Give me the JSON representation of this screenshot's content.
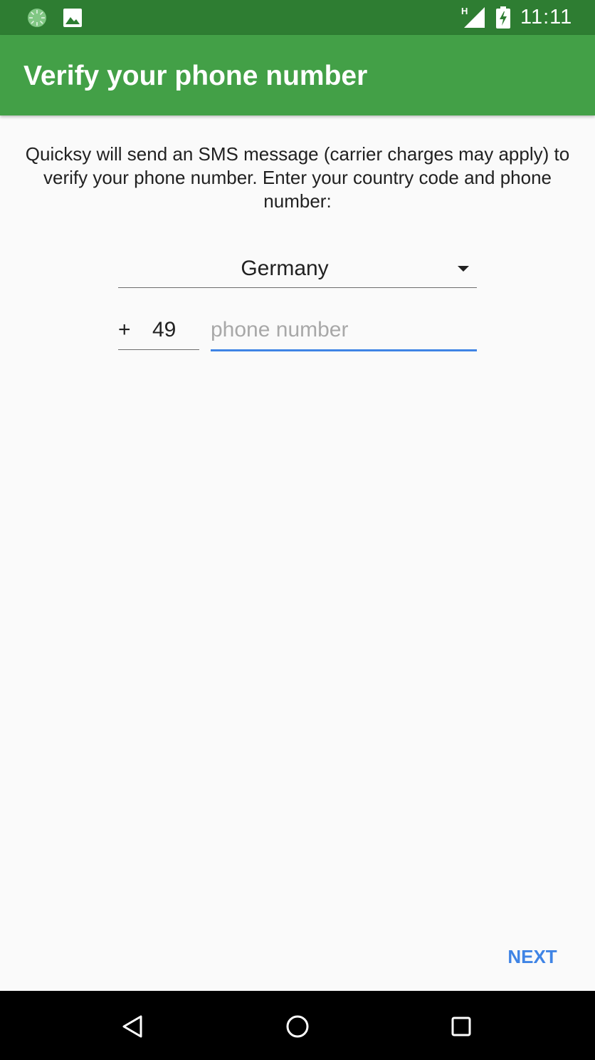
{
  "status_bar": {
    "time": "11:11",
    "network_type": "H",
    "icons": [
      "loading-spinner-icon",
      "image-notification-icon",
      "cellular-signal-icon",
      "battery-charging-icon"
    ]
  },
  "toolbar": {
    "title": "Verify your phone number"
  },
  "main": {
    "instructions": "Quicksy will send an SMS message (carrier charges may apply) to verify your phone number. Enter your country code and phone number:",
    "country_spinner": {
      "selected": "Germany"
    },
    "plus_sign": "+",
    "country_code": "49",
    "phone_number": {
      "value": "",
      "placeholder": "phone number"
    }
  },
  "footer": {
    "next_label": "NEXT"
  },
  "nav_bar": {
    "buttons": [
      "back-icon",
      "home-icon",
      "recents-icon"
    ]
  },
  "colors": {
    "status_bar": "#2e7d32",
    "toolbar": "#43a047",
    "accent": "#3f84e5",
    "background": "#fafafa"
  }
}
